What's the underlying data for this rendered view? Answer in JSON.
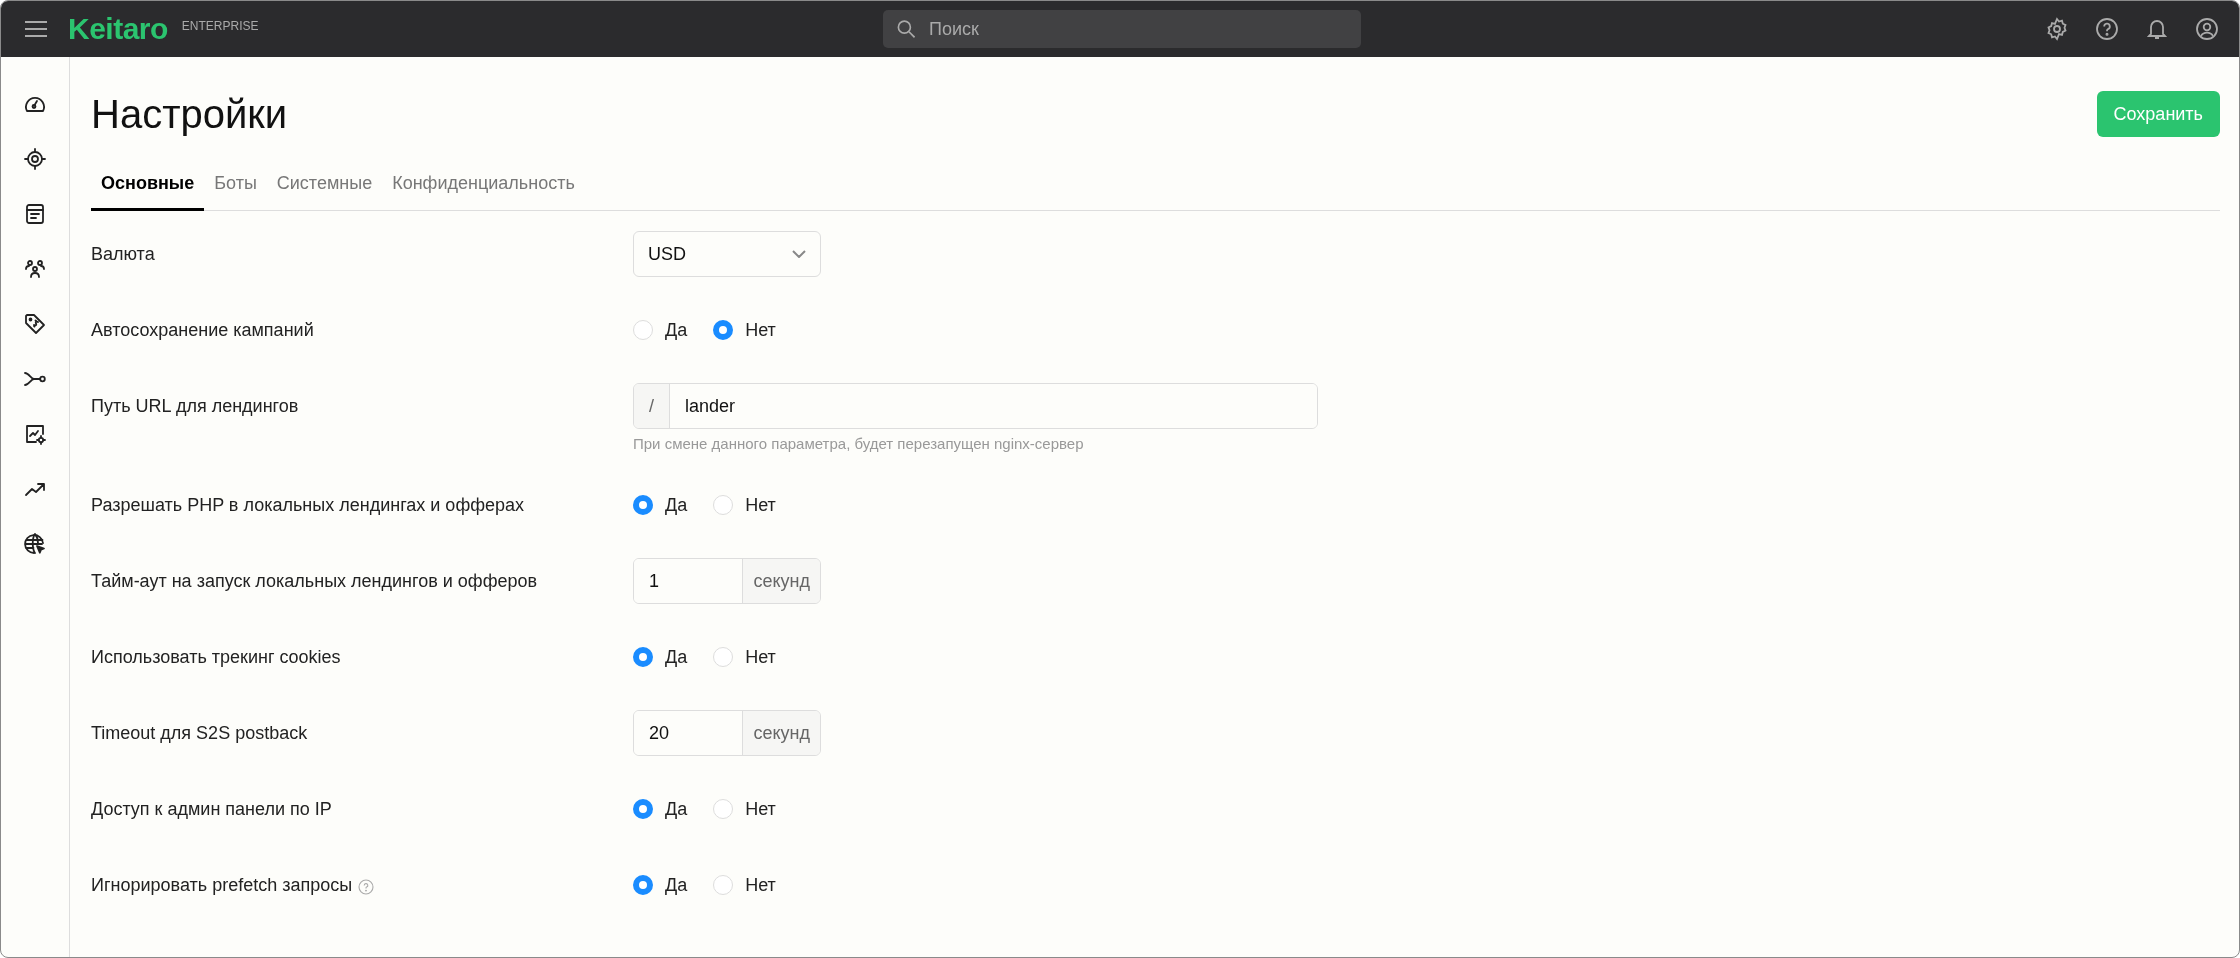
{
  "topbar": {
    "logo": "Keitaro",
    "edition": "ENTERPRISE",
    "search": {
      "placeholder": "Поиск"
    }
  },
  "page": {
    "title": "Настройки",
    "save_button": "Сохранить",
    "tabs": [
      {
        "label": "Основные",
        "selected": true
      },
      {
        "label": "Боты",
        "selected": false
      },
      {
        "label": "Системные",
        "selected": false
      },
      {
        "label": "Конфиденциальность",
        "selected": false
      }
    ]
  },
  "settings": [
    {
      "kind": "select",
      "label": "Валюта",
      "value": "USD"
    },
    {
      "kind": "radio",
      "label": "Автосохранение кампаний",
      "options": [
        {
          "label": "Да",
          "selected": false
        },
        {
          "label": "Нет",
          "selected": true
        }
      ]
    },
    {
      "kind": "prefixed",
      "label": "Путь URL для лендингов",
      "prefix": "/",
      "value": "lander",
      "hint": "При смене данного параметра, будет перезапущен nginx-сервер"
    },
    {
      "kind": "radio",
      "label": "Разрешать PHP в локальных лендингах и офферах",
      "options": [
        {
          "label": "Да",
          "selected": true
        },
        {
          "label": "Нет",
          "selected": false
        }
      ]
    },
    {
      "kind": "unit",
      "label": "Тайм-аут на запуск локальных лендингов и офферов",
      "value": "1",
      "unit": "секунд"
    },
    {
      "kind": "radio",
      "label": "Использовать трекинг cookies",
      "options": [
        {
          "label": "Да",
          "selected": true
        },
        {
          "label": "Нет",
          "selected": false
        }
      ]
    },
    {
      "kind": "unit",
      "label": "Timeout для S2S postback",
      "value": "20",
      "unit": "секунд"
    },
    {
      "kind": "radio",
      "label": "Доступ к админ панели по IP",
      "options": [
        {
          "label": "Да",
          "selected": true
        },
        {
          "label": "Нет",
          "selected": false
        }
      ]
    },
    {
      "kind": "radio",
      "label": "Игнорировать prefetch запросы",
      "help": true,
      "options": [
        {
          "label": "Да",
          "selected": true
        },
        {
          "label": "Нет",
          "selected": false
        }
      ]
    }
  ]
}
